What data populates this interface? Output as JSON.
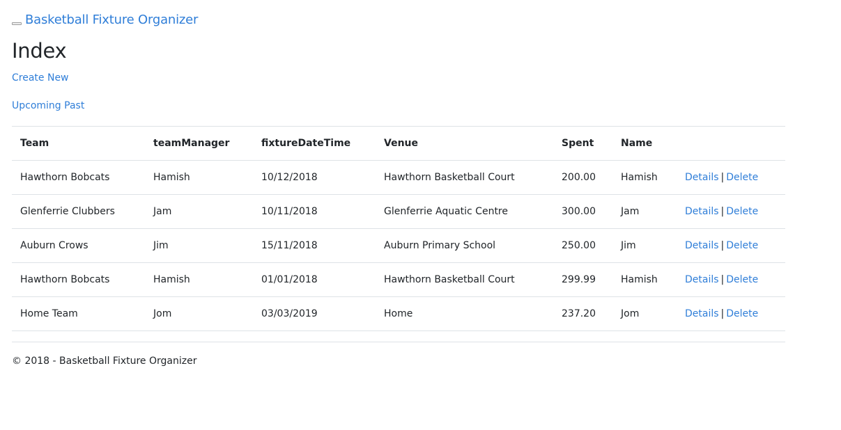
{
  "navbar": {
    "brand": "Basketball Fixture Organizer"
  },
  "page": {
    "title": "Index",
    "create_new": "Create New",
    "filters": [
      "Upcoming",
      "Past"
    ]
  },
  "table": {
    "headers": [
      "Team",
      "teamManager",
      "fixtureDateTime",
      "Venue",
      "Spent",
      "Name"
    ],
    "rows": [
      {
        "team": "Hawthorn Bobcats",
        "manager": "Hamish",
        "date": "10/12/2018",
        "venue": "Hawthorn Basketball Court",
        "spent": "200.00",
        "name": "Hamish"
      },
      {
        "team": "Glenferrie Clubbers",
        "manager": "Jam",
        "date": "10/11/2018",
        "venue": "Glenferrie Aquatic Centre",
        "spent": "300.00",
        "name": "Jam"
      },
      {
        "team": "Auburn Crows",
        "manager": "Jim",
        "date": "15/11/2018",
        "venue": "Auburn Primary School",
        "spent": "250.00",
        "name": "Jim"
      },
      {
        "team": "Hawthorn Bobcats",
        "manager": "Hamish",
        "date": "01/01/2018",
        "venue": "Hawthorn Basketball Court",
        "spent": "299.99",
        "name": "Hamish"
      },
      {
        "team": "Home Team",
        "manager": "Jom",
        "date": "03/03/2019",
        "venue": "Home",
        "spent": "237.20",
        "name": "Jom"
      }
    ],
    "actions": {
      "details": "Details",
      "separator": "|",
      "delete": "Delete"
    }
  },
  "footer": {
    "text": "© 2018 - Basketball Fixture Organizer"
  },
  "colors": {
    "link": "#2f7ed8",
    "text": "#212529",
    "border": "#dee2e6"
  }
}
